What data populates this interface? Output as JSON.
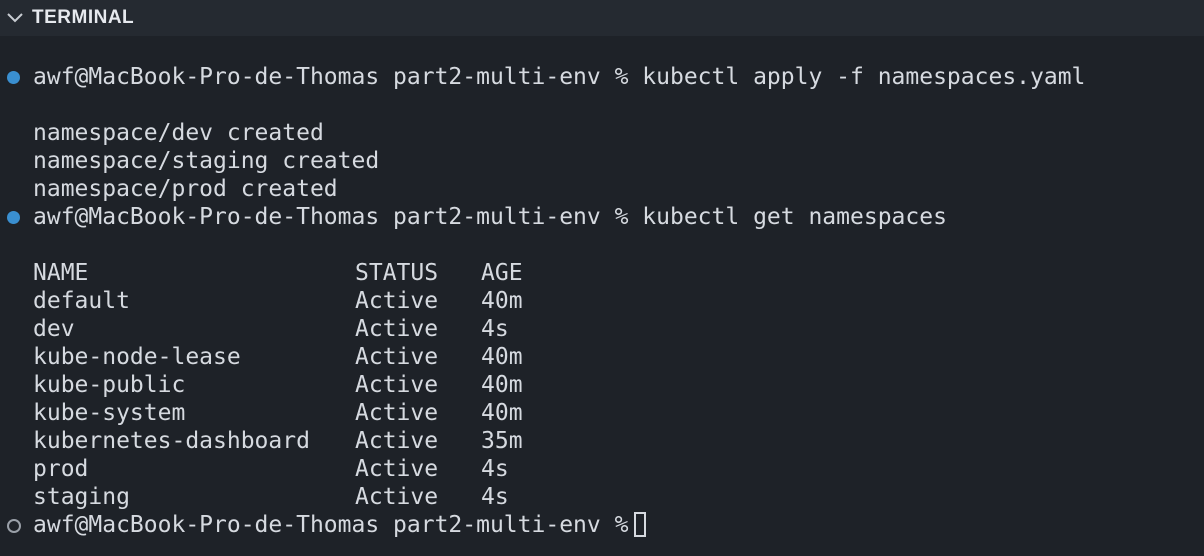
{
  "panel": {
    "title": "TERMINAL"
  },
  "terminal": {
    "prompt": "awf@MacBook-Pro-de-Thomas part2-multi-env %",
    "commands": [
      {
        "text": "kubectl apply -f namespaces.yaml"
      },
      {
        "text": "kubectl get namespaces"
      }
    ],
    "apply_output": [
      "namespace/dev created",
      "namespace/staging created",
      "namespace/prod created"
    ],
    "table": {
      "headers": [
        "NAME",
        "STATUS",
        "AGE"
      ],
      "rows": [
        [
          "default",
          "Active",
          "40m"
        ],
        [
          "dev",
          "Active",
          "4s"
        ],
        [
          "kube-node-lease",
          "Active",
          "40m"
        ],
        [
          "kube-public",
          "Active",
          "40m"
        ],
        [
          "kube-system",
          "Active",
          "40m"
        ],
        [
          "kubernetes-dashboard",
          "Active",
          "35m"
        ],
        [
          "prod",
          "Active",
          "4s"
        ],
        [
          "staging",
          "Active",
          "4s"
        ]
      ]
    },
    "colors": {
      "background": "#1e2228",
      "header_background": "#252a31",
      "command_marker": "#3a8fd0",
      "idle_marker": "#9aa0a8"
    },
    "icons": {
      "collapse": "chevron-down-icon",
      "command_status_done": "filled-circle-icon",
      "command_status_idle": "empty-circle-icon"
    }
  }
}
